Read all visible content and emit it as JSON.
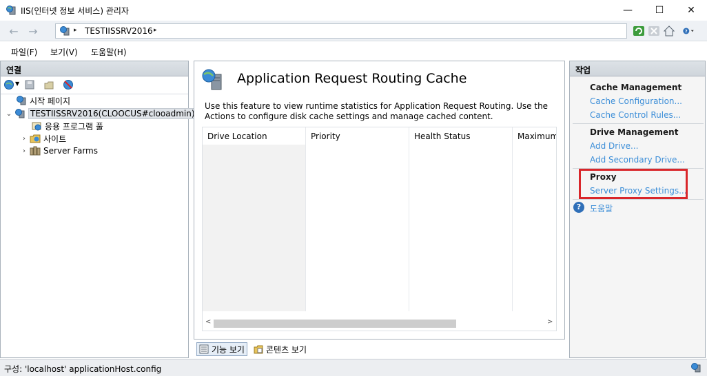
{
  "window": {
    "title": "IIS(인터넷 정보 서비스) 관리자",
    "minimize_glyph": "—",
    "maximize_glyph": "☐",
    "close_glyph": "✕"
  },
  "address": {
    "crumb": "TESTIISSRV2016",
    "back_glyph": "←",
    "forward_glyph": "→",
    "separator": "▸"
  },
  "menu": {
    "items": [
      "파일(F)",
      "보기(V)",
      "도움말(H)"
    ]
  },
  "connections": {
    "header": "연결",
    "tree": {
      "start_page": "시작 페이지",
      "server": "TESTIISSRV2016(CLOOCUS#clooadmin)",
      "app_pools": "응용 프로그램 풀",
      "sites": "사이트",
      "server_farms": "Server Farms",
      "expanded_glyph": "⌄",
      "collapsed_glyph": "›"
    }
  },
  "feature": {
    "title": "Application Request Routing Cache",
    "description": "Use this feature to view runtime statistics for Application Request Routing.  Use the Actions to configure disk cache settings and manage cached content.",
    "columns": [
      "Drive Location",
      "Priority",
      "Health Status",
      "Maximum"
    ],
    "sort_caret": "^",
    "scroll_left": "<",
    "scroll_right": ">"
  },
  "view_tabs": {
    "features": "기능 보기",
    "content": "콘텐츠 보기"
  },
  "actions": {
    "header": "작업",
    "cache_management": {
      "title": "Cache Management",
      "links": [
        "Cache Configuration...",
        "Cache Control Rules..."
      ]
    },
    "drive_management": {
      "title": "Drive Management",
      "links": [
        "Add Drive...",
        "Add Secondary Drive..."
      ]
    },
    "proxy": {
      "title": "Proxy",
      "links": [
        "Server Proxy Settings..."
      ]
    },
    "help": "도움말",
    "help_glyph": "?"
  },
  "status": {
    "text": "구성: 'localhost' applicationHost.config"
  },
  "colors": {
    "link": "#3c8ed8",
    "highlight": "#d9262a",
    "panel_header": "#d4dae0"
  },
  "icons": [
    "iis-icon",
    "globe-server-icon",
    "back-arrow-icon",
    "forward-arrow-icon",
    "refresh-icon",
    "stop-icon",
    "home-icon",
    "help-icon",
    "app-pool-icon",
    "sites-icon",
    "server-farm-icon"
  ]
}
